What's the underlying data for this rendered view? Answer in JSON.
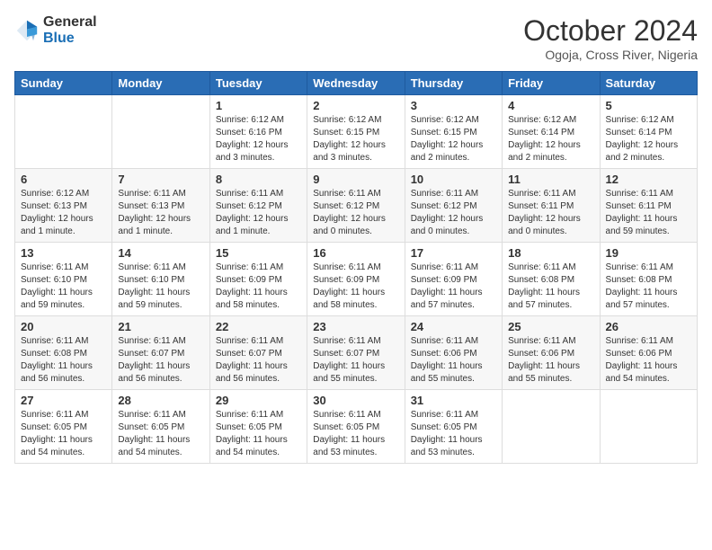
{
  "header": {
    "logo": {
      "general": "General",
      "blue": "Blue"
    },
    "title": "October 2024",
    "subtitle": "Ogoja, Cross River, Nigeria"
  },
  "days_of_week": [
    "Sunday",
    "Monday",
    "Tuesday",
    "Wednesday",
    "Thursday",
    "Friday",
    "Saturday"
  ],
  "weeks": [
    [
      {
        "day": "",
        "info": ""
      },
      {
        "day": "",
        "info": ""
      },
      {
        "day": "1",
        "info": "Sunrise: 6:12 AM\nSunset: 6:16 PM\nDaylight: 12 hours and 3 minutes."
      },
      {
        "day": "2",
        "info": "Sunrise: 6:12 AM\nSunset: 6:15 PM\nDaylight: 12 hours and 3 minutes."
      },
      {
        "day": "3",
        "info": "Sunrise: 6:12 AM\nSunset: 6:15 PM\nDaylight: 12 hours and 2 minutes."
      },
      {
        "day": "4",
        "info": "Sunrise: 6:12 AM\nSunset: 6:14 PM\nDaylight: 12 hours and 2 minutes."
      },
      {
        "day": "5",
        "info": "Sunrise: 6:12 AM\nSunset: 6:14 PM\nDaylight: 12 hours and 2 minutes."
      }
    ],
    [
      {
        "day": "6",
        "info": "Sunrise: 6:12 AM\nSunset: 6:13 PM\nDaylight: 12 hours and 1 minute."
      },
      {
        "day": "7",
        "info": "Sunrise: 6:11 AM\nSunset: 6:13 PM\nDaylight: 12 hours and 1 minute."
      },
      {
        "day": "8",
        "info": "Sunrise: 6:11 AM\nSunset: 6:12 PM\nDaylight: 12 hours and 1 minute."
      },
      {
        "day": "9",
        "info": "Sunrise: 6:11 AM\nSunset: 6:12 PM\nDaylight: 12 hours and 0 minutes."
      },
      {
        "day": "10",
        "info": "Sunrise: 6:11 AM\nSunset: 6:12 PM\nDaylight: 12 hours and 0 minutes."
      },
      {
        "day": "11",
        "info": "Sunrise: 6:11 AM\nSunset: 6:11 PM\nDaylight: 12 hours and 0 minutes."
      },
      {
        "day": "12",
        "info": "Sunrise: 6:11 AM\nSunset: 6:11 PM\nDaylight: 11 hours and 59 minutes."
      }
    ],
    [
      {
        "day": "13",
        "info": "Sunrise: 6:11 AM\nSunset: 6:10 PM\nDaylight: 11 hours and 59 minutes."
      },
      {
        "day": "14",
        "info": "Sunrise: 6:11 AM\nSunset: 6:10 PM\nDaylight: 11 hours and 59 minutes."
      },
      {
        "day": "15",
        "info": "Sunrise: 6:11 AM\nSunset: 6:09 PM\nDaylight: 11 hours and 58 minutes."
      },
      {
        "day": "16",
        "info": "Sunrise: 6:11 AM\nSunset: 6:09 PM\nDaylight: 11 hours and 58 minutes."
      },
      {
        "day": "17",
        "info": "Sunrise: 6:11 AM\nSunset: 6:09 PM\nDaylight: 11 hours and 57 minutes."
      },
      {
        "day": "18",
        "info": "Sunrise: 6:11 AM\nSunset: 6:08 PM\nDaylight: 11 hours and 57 minutes."
      },
      {
        "day": "19",
        "info": "Sunrise: 6:11 AM\nSunset: 6:08 PM\nDaylight: 11 hours and 57 minutes."
      }
    ],
    [
      {
        "day": "20",
        "info": "Sunrise: 6:11 AM\nSunset: 6:08 PM\nDaylight: 11 hours and 56 minutes."
      },
      {
        "day": "21",
        "info": "Sunrise: 6:11 AM\nSunset: 6:07 PM\nDaylight: 11 hours and 56 minutes."
      },
      {
        "day": "22",
        "info": "Sunrise: 6:11 AM\nSunset: 6:07 PM\nDaylight: 11 hours and 56 minutes."
      },
      {
        "day": "23",
        "info": "Sunrise: 6:11 AM\nSunset: 6:07 PM\nDaylight: 11 hours and 55 minutes."
      },
      {
        "day": "24",
        "info": "Sunrise: 6:11 AM\nSunset: 6:06 PM\nDaylight: 11 hours and 55 minutes."
      },
      {
        "day": "25",
        "info": "Sunrise: 6:11 AM\nSunset: 6:06 PM\nDaylight: 11 hours and 55 minutes."
      },
      {
        "day": "26",
        "info": "Sunrise: 6:11 AM\nSunset: 6:06 PM\nDaylight: 11 hours and 54 minutes."
      }
    ],
    [
      {
        "day": "27",
        "info": "Sunrise: 6:11 AM\nSunset: 6:05 PM\nDaylight: 11 hours and 54 minutes."
      },
      {
        "day": "28",
        "info": "Sunrise: 6:11 AM\nSunset: 6:05 PM\nDaylight: 11 hours and 54 minutes."
      },
      {
        "day": "29",
        "info": "Sunrise: 6:11 AM\nSunset: 6:05 PM\nDaylight: 11 hours and 54 minutes."
      },
      {
        "day": "30",
        "info": "Sunrise: 6:11 AM\nSunset: 6:05 PM\nDaylight: 11 hours and 53 minutes."
      },
      {
        "day": "31",
        "info": "Sunrise: 6:11 AM\nSunset: 6:05 PM\nDaylight: 11 hours and 53 minutes."
      },
      {
        "day": "",
        "info": ""
      },
      {
        "day": "",
        "info": ""
      }
    ]
  ]
}
